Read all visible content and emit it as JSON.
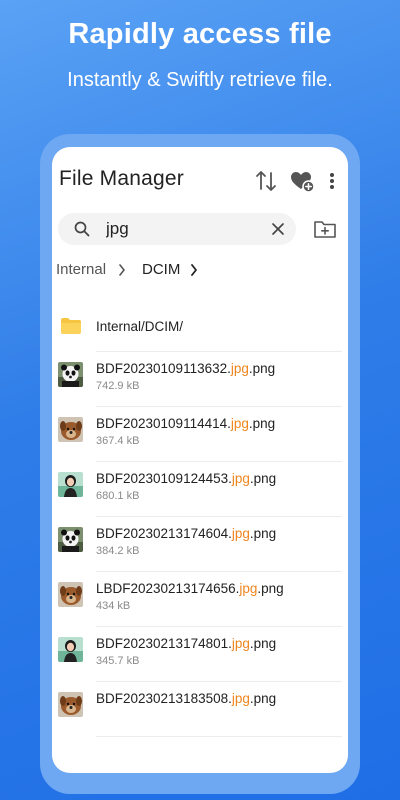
{
  "promo": {
    "headline": "Rapidly access file",
    "subline": "Instantly & Swiftly retrieve file."
  },
  "app": {
    "title": "File Manager",
    "icons": {
      "sort": "sort-arrows-icon",
      "favorites": "heart-add-icon",
      "more": "more-vertical-icon",
      "new_folder": "folder-add-icon"
    }
  },
  "search": {
    "value": "jpg",
    "placeholder": ""
  },
  "breadcrumb": [
    {
      "label": "Internal"
    },
    {
      "label": "DCIM"
    }
  ],
  "folder_result": {
    "name": "Internal/DCIM/"
  },
  "highlight_color": "#f0851d",
  "files": [
    {
      "prefix": "BDF20230109113632.",
      "match": "jpg",
      "suffix": ".png",
      "size": "742.9 kB",
      "thumb": "panda"
    },
    {
      "prefix": "BDF20230109114414.",
      "match": "jpg",
      "suffix": ".png",
      "size": "367.4 kB",
      "thumb": "dog"
    },
    {
      "prefix": "BDF20230109124453.",
      "match": "jpg",
      "suffix": ".png",
      "size": "680.1 kB",
      "thumb": "person"
    },
    {
      "prefix": "BDF20230213174604.",
      "match": "jpg",
      "suffix": ".png",
      "size": "384.2 kB",
      "thumb": "panda"
    },
    {
      "prefix": "LBDF20230213174656.",
      "match": "jpg",
      "suffix": ".png",
      "size": "434 kB",
      "thumb": "dog"
    },
    {
      "prefix": "BDF20230213174801.",
      "match": "jpg",
      "suffix": ".png",
      "size": "345.7 kB",
      "thumb": "person"
    },
    {
      "prefix": "BDF20230213183508.",
      "match": "jpg",
      "suffix": ".png",
      "size": "",
      "thumb": "dog"
    }
  ]
}
